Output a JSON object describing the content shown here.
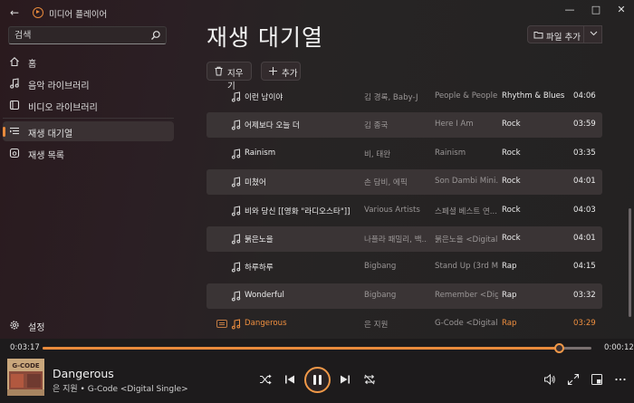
{
  "app": {
    "title": "미디어 플레이어",
    "accent": "#e88a3c"
  },
  "search": {
    "placeholder": "검색"
  },
  "nav": {
    "items": [
      {
        "label": "홈",
        "icon": "home-icon"
      },
      {
        "label": "음악 라이브러리",
        "icon": "music-note-icon"
      },
      {
        "label": "비디오 라이브러리",
        "icon": "video-icon"
      },
      {
        "label": "재생 대기열",
        "icon": "queue-icon"
      },
      {
        "label": "재생 목록",
        "icon": "playlist-icon"
      }
    ],
    "active_index": 3,
    "settings_label": "설정"
  },
  "main": {
    "title": "재생 대기열",
    "add_file_label": "파일 추가",
    "clear_label": "지우기",
    "add_label": "추가"
  },
  "queue": [
    {
      "title": "이런 남이야",
      "artist": "김 경록, Baby-J",
      "album": "People & People",
      "genre": "Rhythm & Blues",
      "duration": "04:06",
      "shaded": false,
      "playing": false
    },
    {
      "title": "어제보다 오늘 더",
      "artist": "김 종국",
      "album": "Here I Am",
      "genre": "Rock",
      "duration": "03:59",
      "shaded": true,
      "playing": false
    },
    {
      "title": "Rainism",
      "artist": "비, 태완",
      "album": "Rainism",
      "genre": "Rock",
      "duration": "03:35",
      "shaded": false,
      "playing": false
    },
    {
      "title": "미쳤어",
      "artist": "손 담비, 에픽",
      "album": "Son Dambi Mini...",
      "genre": "Rock",
      "duration": "04:01",
      "shaded": true,
      "playing": false
    },
    {
      "title": "비와 당신 [[영화 \"라디오스타\"]]",
      "artist": "Various Artists",
      "album": "스페셜 베스트 연...",
      "genre": "Rock",
      "duration": "04:03",
      "shaded": false,
      "playing": false
    },
    {
      "title": "붉은노을",
      "artist": "나플라 패밀리, 백...",
      "album": "붉은노을 <Digital...",
      "genre": "Rock",
      "duration": "04:01",
      "shaded": true,
      "playing": false
    },
    {
      "title": "하루하루",
      "artist": "Bigbang",
      "album": "Stand Up (3rd Mi...",
      "genre": "Rap",
      "duration": "04:15",
      "shaded": false,
      "playing": false
    },
    {
      "title": "Wonderful",
      "artist": "Bigbang",
      "album": "Remember <Digital...",
      "genre": "Rap",
      "duration": "03:32",
      "shaded": true,
      "playing": false
    },
    {
      "title": "Dangerous",
      "artist": "은 지원",
      "album": "G-Code <Digital...",
      "genre": "Rap",
      "duration": "03:29",
      "shaded": false,
      "playing": true
    }
  ],
  "player": {
    "elapsed": "0:03:17",
    "remaining": "0:00:12",
    "progress_fraction": 0.94,
    "track_title": "Dangerous",
    "track_subtitle": "은 지원 • G-Code <Digital Single>",
    "album_art_text": "G-CODE"
  }
}
